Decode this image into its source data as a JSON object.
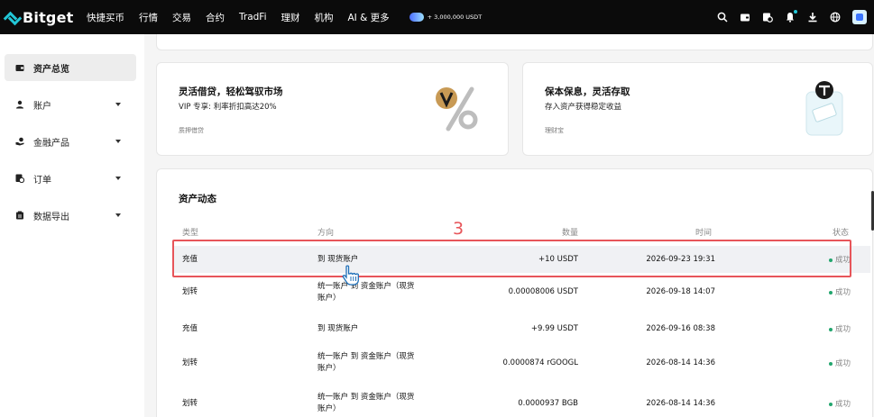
{
  "brand": {
    "name": "Bitget",
    "accent": "#22c6d6"
  },
  "nav": {
    "items": [
      "快捷买币",
      "行情",
      "交易",
      "合约",
      "TradFi",
      "理财",
      "机构",
      "AI & 更多"
    ],
    "promo_text": "+ 3,000,000 USDT",
    "right_icons": [
      "search-icon",
      "wallet-icon",
      "orders-icon",
      "bell-icon",
      "download-icon",
      "globe-icon",
      "avatar"
    ]
  },
  "sidebar": {
    "items": [
      {
        "label": "资产总览",
        "icon": "wallet-icon",
        "active": true,
        "expandable": false
      },
      {
        "label": "账户",
        "icon": "user-icon",
        "active": false,
        "expandable": true
      },
      {
        "label": "金融产品",
        "icon": "finance-icon",
        "active": false,
        "expandable": true
      },
      {
        "label": "订单",
        "icon": "order-icon",
        "active": false,
        "expandable": true
      },
      {
        "label": "数据导出",
        "icon": "export-icon",
        "active": false,
        "expandable": true
      }
    ]
  },
  "promos": [
    {
      "title": "灵活借贷，轻松驾驭市场",
      "subtitle": "VIP 专享: 利率折扣高达20%",
      "tag": "质押借贷"
    },
    {
      "title": "保本保息，灵活存取",
      "subtitle": "存入资产获得稳定收益",
      "tag": "理财宝"
    }
  ],
  "activity": {
    "title": "资产动态",
    "headers": {
      "type": "类型",
      "direction": "方向",
      "amount": "数量",
      "time": "时间",
      "status": "状态"
    },
    "rows": [
      {
        "type": "充值",
        "direction": "到 现货账户",
        "amount": "+10 USDT",
        "time": "2026-09-23 19:31",
        "status": "成功"
      },
      {
        "type": "划转",
        "direction": "统一账户 到 资金账户（现货账户）",
        "amount": "0.00008006 USDT",
        "time": "2026-09-18 14:07",
        "status": "成功"
      },
      {
        "type": "充值",
        "direction": "到 现货账户",
        "amount": "+9.99 USDT",
        "time": "2026-09-16 08:38",
        "status": "成功"
      },
      {
        "type": "划转",
        "direction": "统一账户 到 资金账户（现货账户）",
        "amount": "0.0000874 rGOOGL",
        "time": "2026-08-14 14:36",
        "status": "成功"
      },
      {
        "type": "划转",
        "direction": "统一账户 到 资金账户（现货账户）",
        "amount": "0.0000937 BGB",
        "time": "2026-08-14 14:36",
        "status": "成功"
      }
    ]
  },
  "annotation": {
    "step_number": "3",
    "color": "#e7555a"
  },
  "colors": {
    "success": "#22a66e",
    "topbar": "#0b0b0b"
  }
}
